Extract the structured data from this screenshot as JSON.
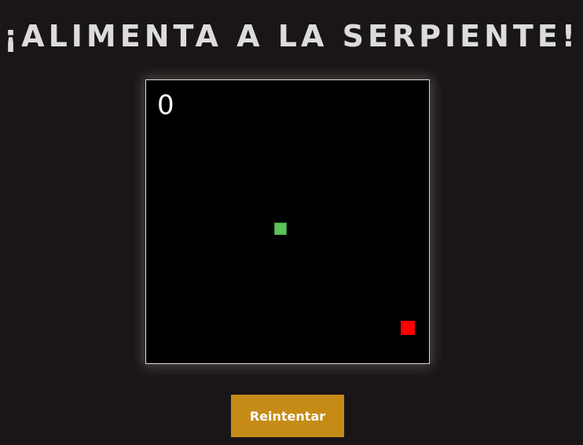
{
  "title": "¡ALIMENTA A LA SERPIENTE!",
  "score": "0",
  "retry_label": "Reintentar",
  "colors": {
    "background": "#1a1617",
    "board": "#000000",
    "snake": "#5cc25a",
    "food": "#ff0000",
    "button": "#c68b17",
    "title": "#dcdcdc"
  },
  "game": {
    "grid_cols": 20,
    "grid_rows": 20,
    "snake": [
      {
        "col": 9,
        "row": 10
      }
    ],
    "food": {
      "col": 18,
      "row": 17
    }
  }
}
